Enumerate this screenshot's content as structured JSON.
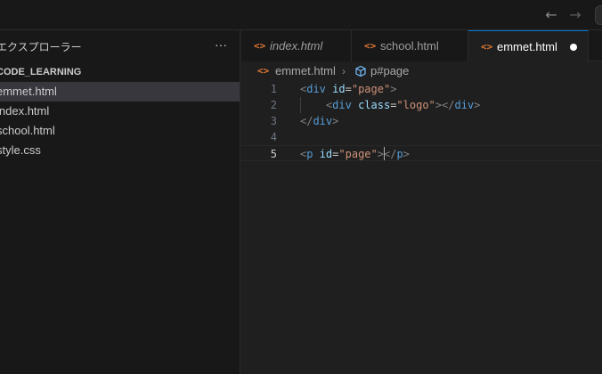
{
  "titlebar": {
    "back_icon": "arrow-left-icon",
    "forward_icon": "arrow-right-icon"
  },
  "sidebar": {
    "title": "エクスプローラー",
    "more_label": "···",
    "folder": "CODE_LEARNING",
    "files": [
      {
        "name": "emmet.html",
        "active": true
      },
      {
        "name": "index.html",
        "active": false
      },
      {
        "name": "school.html",
        "active": false
      },
      {
        "name": "style.css",
        "active": false
      }
    ]
  },
  "tabs": [
    {
      "label": "index.html",
      "icon": "<>",
      "italic": true,
      "active": false
    },
    {
      "label": "school.html",
      "icon": "<>",
      "italic": false,
      "active": false
    },
    {
      "label": "emmet.html",
      "icon": "<>",
      "italic": false,
      "active": true,
      "modified": true
    }
  ],
  "breadcrumb": {
    "file_icon": "<>",
    "file": "emmet.html",
    "separator": "›",
    "element": "p#page"
  },
  "editor": {
    "current_line": 5,
    "lines": [
      {
        "num": "1",
        "indent": "",
        "parts": [
          [
            "<",
            "b"
          ],
          [
            "div",
            "t"
          ],
          [
            " ",
            ""
          ],
          [
            "id",
            "a"
          ],
          [
            "=",
            "e"
          ],
          [
            "\"page\"",
            "s"
          ],
          [
            ">",
            "b"
          ]
        ]
      },
      {
        "num": "2",
        "indent": "    ",
        "parts": [
          [
            "<",
            "b"
          ],
          [
            "div",
            "t"
          ],
          [
            " ",
            ""
          ],
          [
            "class",
            "a"
          ],
          [
            "=",
            "e"
          ],
          [
            "\"logo\"",
            "s"
          ],
          [
            ">",
            "b"
          ],
          [
            "</",
            "b"
          ],
          [
            "div",
            "t"
          ],
          [
            ">",
            "b"
          ]
        ]
      },
      {
        "num": "3",
        "indent": "",
        "parts": [
          [
            "</",
            "b"
          ],
          [
            "div",
            "t"
          ],
          [
            ">",
            "b"
          ]
        ]
      },
      {
        "num": "4",
        "indent": "",
        "parts": []
      },
      {
        "num": "5",
        "indent": "",
        "parts": [
          [
            "<",
            "b"
          ],
          [
            "p",
            "t"
          ],
          [
            " ",
            ""
          ],
          [
            "id",
            "a"
          ],
          [
            "=",
            "e"
          ],
          [
            "\"page\"",
            "s"
          ],
          [
            ">",
            "b"
          ],
          [
            "|cursor|",
            "c"
          ],
          [
            "</",
            "b"
          ],
          [
            "p",
            "t"
          ],
          [
            ">",
            "b"
          ]
        ]
      }
    ]
  }
}
